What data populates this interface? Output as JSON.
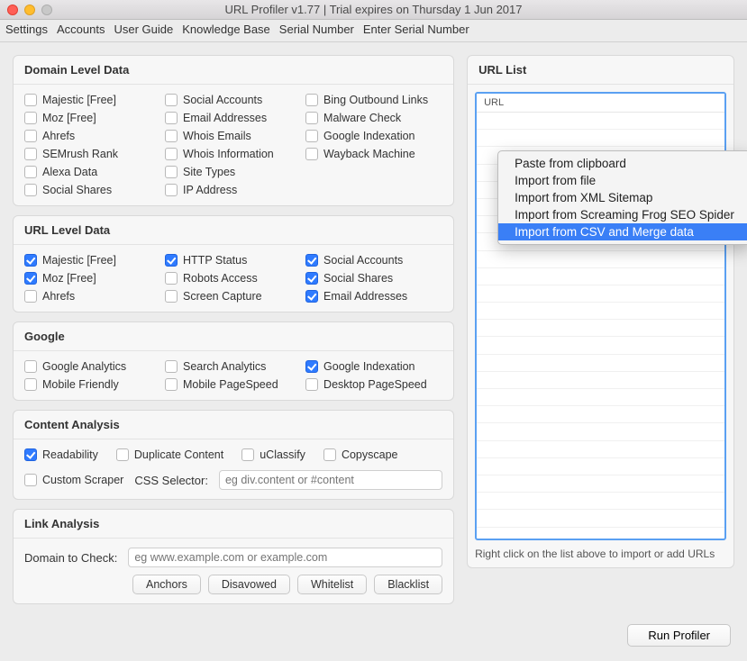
{
  "window": {
    "title": "URL Profiler v1.77 | Trial expires on Thursday 1 Jun 2017"
  },
  "menubar": [
    "Settings",
    "Accounts",
    "User Guide",
    "Knowledge Base",
    "Serial Number",
    "Enter Serial Number"
  ],
  "panels": {
    "domain": {
      "title": "Domain Level Data",
      "items": [
        {
          "label": "Majestic [Free]",
          "checked": false
        },
        {
          "label": "Social Accounts",
          "checked": false
        },
        {
          "label": "Bing Outbound Links",
          "checked": false
        },
        {
          "label": "Moz [Free]",
          "checked": false
        },
        {
          "label": "Email Addresses",
          "checked": false
        },
        {
          "label": "Malware Check",
          "checked": false
        },
        {
          "label": "Ahrefs",
          "checked": false
        },
        {
          "label": "Whois Emails",
          "checked": false
        },
        {
          "label": "Google Indexation",
          "checked": false
        },
        {
          "label": "SEMrush Rank",
          "checked": false
        },
        {
          "label": "Whois Information",
          "checked": false
        },
        {
          "label": "Wayback Machine",
          "checked": false
        },
        {
          "label": "Alexa Data",
          "checked": false
        },
        {
          "label": "Site Types",
          "checked": false
        },
        {
          "label": "",
          "checked": false,
          "empty": true
        },
        {
          "label": "Social Shares",
          "checked": false
        },
        {
          "label": "IP Address",
          "checked": false
        }
      ]
    },
    "url": {
      "title": "URL Level Data",
      "items": [
        {
          "label": "Majestic [Free]",
          "checked": true
        },
        {
          "label": "HTTP Status",
          "checked": true
        },
        {
          "label": "Social Accounts",
          "checked": true
        },
        {
          "label": "Moz [Free]",
          "checked": true
        },
        {
          "label": "Robots Access",
          "checked": false
        },
        {
          "label": "Social Shares",
          "checked": true
        },
        {
          "label": "Ahrefs",
          "checked": false
        },
        {
          "label": "Screen Capture",
          "checked": false
        },
        {
          "label": "Email Addresses",
          "checked": true
        }
      ]
    },
    "google": {
      "title": "Google",
      "items": [
        {
          "label": "Google Analytics",
          "checked": false
        },
        {
          "label": "Search Analytics",
          "checked": false
        },
        {
          "label": "Google Indexation",
          "checked": true
        },
        {
          "label": "Mobile Friendly",
          "checked": false
        },
        {
          "label": "Mobile PageSpeed",
          "checked": false
        },
        {
          "label": "Desktop PageSpeed",
          "checked": false
        }
      ]
    },
    "content": {
      "title": "Content Analysis",
      "row1": [
        {
          "label": "Readability",
          "checked": true
        },
        {
          "label": "Duplicate Content",
          "checked": false
        },
        {
          "label": "uClassify",
          "checked": false
        },
        {
          "label": "Copyscape",
          "checked": false
        }
      ],
      "custom_scraper": {
        "label": "Custom Scraper",
        "checked": false
      },
      "css_selector_label": "CSS Selector:",
      "css_selector_placeholder": "eg div.content or #content"
    },
    "link": {
      "title": "Link Analysis",
      "domain_label": "Domain to Check:",
      "domain_placeholder": "eg www.example.com or example.com",
      "buttons": [
        "Anchors",
        "Disavowed",
        "Whitelist",
        "Blacklist"
      ]
    },
    "urllist": {
      "title": "URL List",
      "column": "URL",
      "hint": "Right click on the list above to import or add URLs"
    }
  },
  "context_menu": {
    "items": [
      "Paste from clipboard",
      "Import from file",
      "Import from XML Sitemap",
      "Import from Screaming Frog SEO Spider",
      "Import from CSV and Merge data"
    ],
    "active_index": 4
  },
  "footer": {
    "run_label": "Run Profiler"
  }
}
